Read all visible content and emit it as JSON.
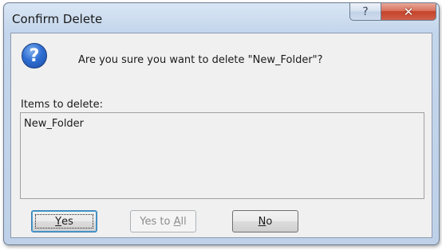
{
  "window": {
    "title": "Confirm Delete",
    "help_label": "?",
    "close_label": "✕"
  },
  "dialog": {
    "icon": "question-icon",
    "question": "Are you sure you want to delete \"New_Folder\"?",
    "items_label": "Items to delete:",
    "items": [
      "New_Folder"
    ]
  },
  "buttons": {
    "yes": {
      "accel": "Y",
      "rest": "es",
      "enabled": true,
      "default": true
    },
    "yes_to_all": {
      "before": "Yes to ",
      "accel": "A",
      "rest": "ll",
      "enabled": false
    },
    "no": {
      "accel": "N",
      "rest": "o",
      "enabled": true
    }
  }
}
